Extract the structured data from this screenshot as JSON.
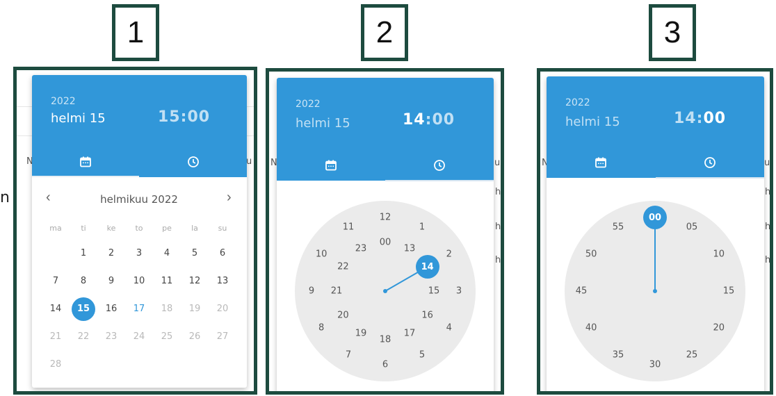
{
  "labels": [
    "1",
    "2",
    "3"
  ],
  "background_fragments": {
    "left_n": "n",
    "col_N": "N",
    "row_h": "h",
    "col_u": "u"
  },
  "colors": {
    "accent": "#3197d9",
    "frame": "#1d4b3f",
    "clock_face": "#ebebeb"
  },
  "icons": {
    "date_tab": "calendar-icon",
    "time_tab": "clock-icon"
  },
  "panel1": {
    "year": "2022",
    "date": "helmi 15",
    "hour": "15",
    "sep": ":",
    "minute": "00",
    "month_title": "helmikuu 2022",
    "prev": "‹",
    "next": "›",
    "weekdays": [
      "ma",
      "ti",
      "ke",
      "to",
      "pe",
      "la",
      "su"
    ],
    "weeks": [
      [
        "",
        "1",
        "2",
        "3",
        "4",
        "5",
        "6"
      ],
      [
        "7",
        "8",
        "9",
        "10",
        "11",
        "12",
        "13"
      ],
      [
        "14",
        "15",
        "16",
        "17",
        "18",
        "19",
        "20"
      ],
      [
        "21",
        "22",
        "23",
        "24",
        "25",
        "26",
        "27"
      ],
      [
        "28",
        "",
        "",
        "",
        "",
        "",
        ""
      ]
    ],
    "selected_day": "15",
    "today_day": "17"
  },
  "panel2": {
    "year": "2022",
    "date": "helmi 15",
    "hour": "14",
    "sep": ":",
    "minute": "00",
    "outer_hours": [
      "12",
      "1",
      "2",
      "3",
      "4",
      "5",
      "6",
      "7",
      "8",
      "9",
      "10",
      "11"
    ],
    "inner_hours": [
      "00",
      "13",
      "14",
      "15",
      "16",
      "17",
      "18",
      "19",
      "20",
      "21",
      "22",
      "23"
    ],
    "selected": "14"
  },
  "panel3": {
    "year": "2022",
    "date": "helmi 15",
    "hour": "14",
    "sep": ":",
    "minute": "00",
    "minutes": [
      "00",
      "05",
      "10",
      "15",
      "20",
      "25",
      "30",
      "35",
      "40",
      "45",
      "50",
      "55"
    ],
    "selected": "00"
  }
}
